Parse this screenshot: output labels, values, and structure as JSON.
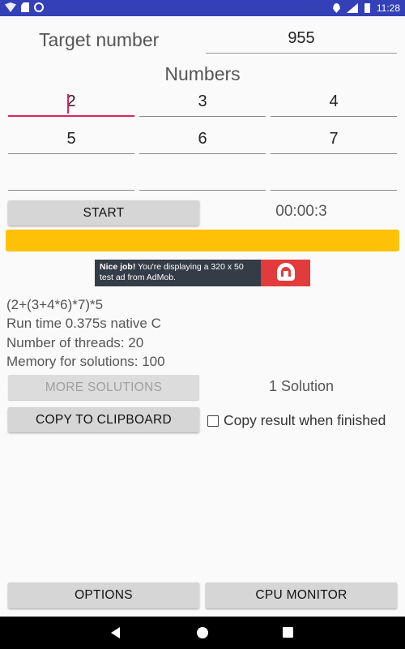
{
  "status_bar": {
    "time": "11:28",
    "icons": [
      "wifi-icon",
      "sim-icon",
      "sync-icon",
      "location-icon",
      "lte-signal-icon",
      "battery-icon"
    ]
  },
  "target": {
    "label": "Target number",
    "value": "955"
  },
  "numbers": {
    "title": "Numbers",
    "values": [
      "2",
      "3",
      "4",
      "5",
      "6",
      "7",
      "",
      "",
      ""
    ]
  },
  "controls": {
    "start_label": "START",
    "timer": "00:00:3",
    "progress_percent": 100,
    "progress_color": "#ffc107"
  },
  "ad": {
    "bold": "Nice job!",
    "text": "You're displaying a 320 x 50 test ad from AdMob."
  },
  "results": {
    "expression": "(2+(3+4*6)*7)*5",
    "run_time": "Run time 0.375s native C",
    "threads": "Number of threads: 20",
    "memory": "Memory for solutions: 100",
    "more_solutions_label": "MORE SOLUTIONS",
    "solution_count": "1 Solution",
    "copy_label": "COPY TO CLIPBOARD",
    "copy_when_finished_label": "Copy result when finished",
    "copy_when_finished_checked": false
  },
  "bottom": {
    "options_label": "OPTIONS",
    "cpu_monitor_label": "CPU MONITOR"
  }
}
